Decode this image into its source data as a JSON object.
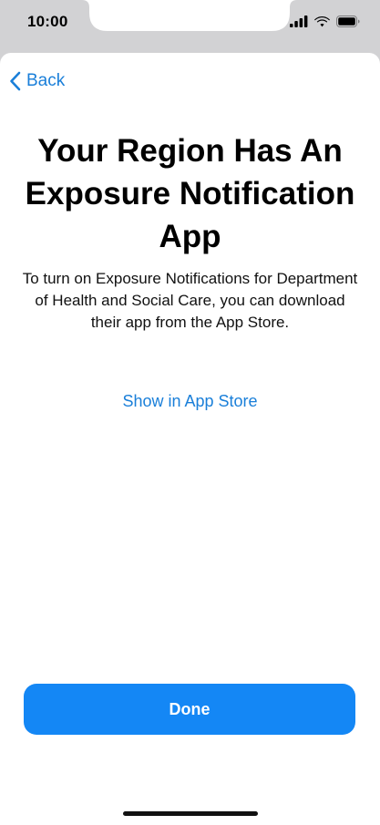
{
  "status_bar": {
    "time": "10:00",
    "icons": [
      "signal-icon",
      "wifi-icon",
      "battery-icon"
    ]
  },
  "nav": {
    "back_label": "Back"
  },
  "content": {
    "title": "Your Region Has An Exposure Notification App",
    "description": "To turn on Exposure Notifications for Department of Health and Social Care, you can download their app from the App Store.",
    "store_link": "Show in App Store"
  },
  "actions": {
    "done_label": "Done"
  },
  "colors": {
    "accent": "#1a7fd9",
    "button": "#1487f5",
    "status_bar_bg": "#d2d2d4"
  }
}
